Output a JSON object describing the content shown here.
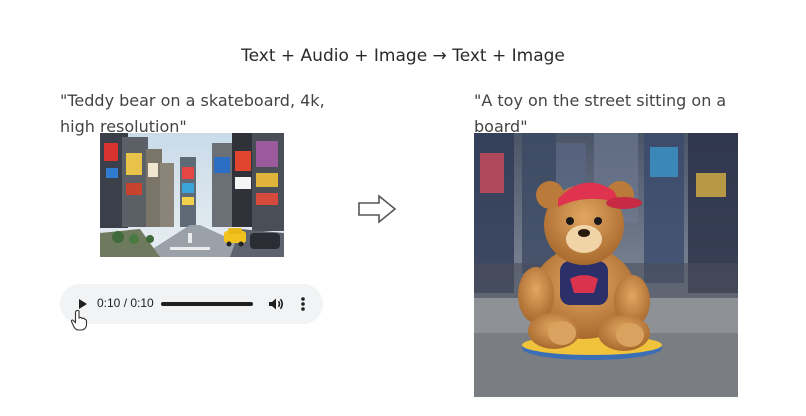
{
  "header": {
    "title": "Text + Audio + Image → Text + Image"
  },
  "input": {
    "prompt": "\"Teddy bear on a skateboard, 4k, high resolution\"",
    "image_icon": "city-street-photo",
    "audio_player": {
      "time_display": "0:10 / 0:10",
      "progress": 1.0,
      "play_icon": "play-icon",
      "volume_icon": "volume-icon",
      "menu_icon": "more-vert-icon"
    }
  },
  "transition": {
    "icon": "right-arrow-icon"
  },
  "output": {
    "caption": "\"A toy on the street sitting on a board\"",
    "image_icon": "teddy-bear-skateboard-photo"
  }
}
